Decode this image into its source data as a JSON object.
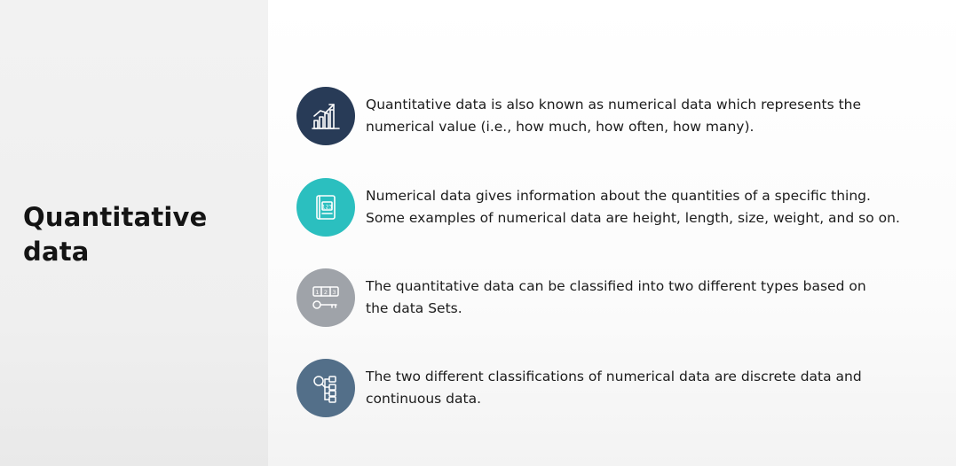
{
  "slide": {
    "title_lines": [
      "Quantitative",
      "data"
    ],
    "items": [
      {
        "icon": "growth-chart-icon",
        "color": "#283b57",
        "lines": [
          "Quantitative data is also known as numerical data which represents the",
          "numerical value (i.e., how much, how often, how many)."
        ]
      },
      {
        "icon": "numbers-book-icon",
        "color": "#2bbfbf",
        "lines": [
          "Numerical data gives information about the quantities of a specific thing.",
          "Some examples of numerical data are height, length, size, weight, and so on."
        ]
      },
      {
        "icon": "number-key-icon",
        "color": "#9fa3a9",
        "lines": [
          "The quantitative data can be classified into two different types based on",
          "the data Sets."
        ]
      },
      {
        "icon": "hierarchy-classification-icon",
        "color": "#536f89",
        "lines": [
          "The two different classifications of numerical data are discrete data and",
          "continuous data."
        ]
      }
    ]
  }
}
